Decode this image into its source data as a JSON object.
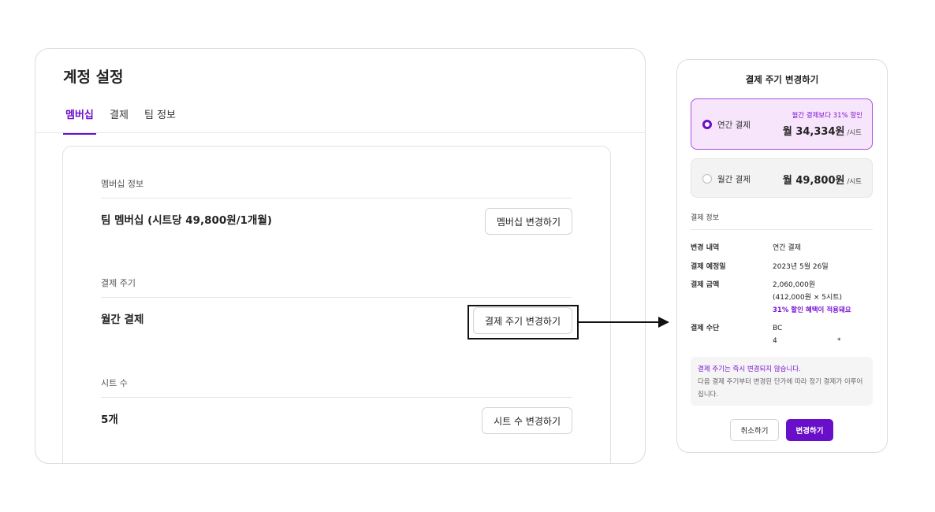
{
  "settings": {
    "title": "계정 설정",
    "tabs": [
      {
        "label": "멤버십",
        "active": true
      },
      {
        "label": "결제",
        "active": false
      },
      {
        "label": "팀 정보",
        "active": false
      }
    ],
    "sections": [
      {
        "label": "멤버십 정보",
        "value": "팀 멤버십 (시트당 49,800원/1개월)",
        "button": "멤버십 변경하기"
      },
      {
        "label": "결제 주기",
        "value": "월간 결제",
        "button": "결제 주기 변경하기"
      },
      {
        "label": "시트 수",
        "value": "5개",
        "button": "시트 수 변경하기"
      }
    ]
  },
  "modal": {
    "title": "결제 주기 변경하기",
    "plans": [
      {
        "name": "연간 결제",
        "discount": "월간 결제보다 31% 할인",
        "price": "월 34,334원",
        "unit": "/시트",
        "selected": true
      },
      {
        "name": "월간 결제",
        "price": "월 49,800원",
        "unit": "/시트",
        "selected": false
      }
    ],
    "info_label": "결제 정보",
    "info": {
      "change_key": "변경 내역",
      "change_val": "연간 결제",
      "date_key": "결제 예정일",
      "date_val": "2023년 5월 26일",
      "amount_key": "결제 금액",
      "amount_val": "2,060,000원",
      "amount_detail": "(412,000원 × 5시트)",
      "amount_discount": "31% 할인 혜택이 적용돼요",
      "method_key": "결제 수단",
      "method_card": "BC",
      "method_number_start": "4",
      "method_number_end": "*"
    },
    "notice_title": "결제 주기는 즉시 변경되지 않습니다.",
    "notice_body": "다음 결제 주기부터 변경된 단가에 따라 정기 결제가 이루어집니다.",
    "cancel_label": "취소하기",
    "confirm_label": "변경하기"
  },
  "colors": {
    "accent": "#6a0fc9",
    "selected_bg": "#f7e5fb",
    "highlight_border": "#111111"
  }
}
